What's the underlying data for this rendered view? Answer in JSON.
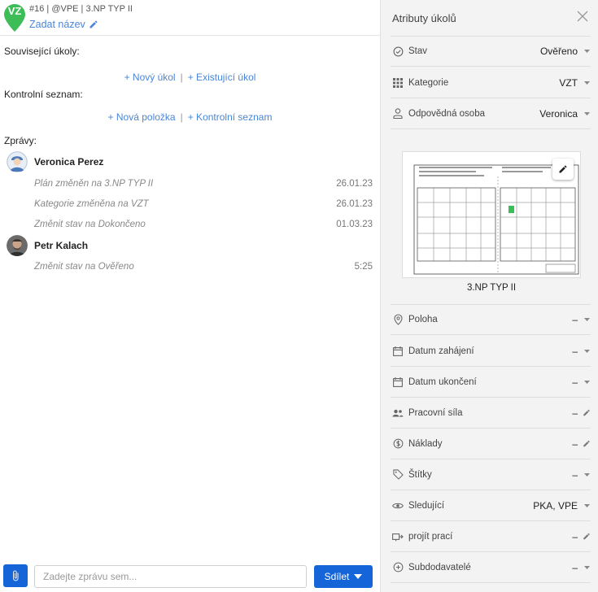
{
  "header": {
    "avatar_initials": "VZ",
    "meta": "#16 | @VPE | 3.NP TYP II",
    "set_name_label": "Zadat název"
  },
  "related": {
    "label": "Související úkoly:",
    "new_task": "+ Nový úkol",
    "existing_task": "+ Existující úkol"
  },
  "checklist": {
    "label": "Kontrolní seznam:",
    "new_item": "+ Nová položka",
    "checklist_link": "+ Kontrolní seznam"
  },
  "messages": {
    "label": "Zprávy:",
    "groups": [
      {
        "user": "Veronica Perez",
        "entries": [
          {
            "text": "Plán změněn na 3.NP TYP II",
            "date": "26.01.23"
          },
          {
            "text": "Kategorie změněna na VZT",
            "date": "26.01.23"
          },
          {
            "text": "Změnit stav na Dokončeno",
            "date": "01.03.23"
          }
        ]
      },
      {
        "user": "Petr Kalach",
        "entries": [
          {
            "text": "Změnit stav na Ověřeno",
            "date": "5:25"
          }
        ]
      }
    ]
  },
  "composer": {
    "placeholder": "Zadejte zprávu sem...",
    "share_label": "Sdílet"
  },
  "panel": {
    "title": "Atributy úkolů",
    "attrs_top": [
      {
        "icon": "check-circle-icon",
        "label": "Stav",
        "value": "Ověřeno"
      },
      {
        "icon": "grid-icon",
        "label": "Kategorie",
        "value": "VZT"
      },
      {
        "icon": "person-icon",
        "label": "Odpovědná osoba",
        "value": "Veronica"
      }
    ],
    "plan_caption": "3.NP TYP II",
    "attrs_bottom": [
      {
        "icon": "location-pin-icon",
        "label": "Poloha",
        "value": "–",
        "trail": "chevron"
      },
      {
        "icon": "calendar-icon",
        "label": "Datum zahájení",
        "value": "–",
        "trail": "chevron"
      },
      {
        "icon": "calendar-icon",
        "label": "Datum ukončení",
        "value": "–",
        "trail": "chevron"
      },
      {
        "icon": "group-icon",
        "label": "Pracovní síla",
        "value": "–",
        "trail": "pencil"
      },
      {
        "icon": "dollar-icon",
        "label": "Náklady",
        "value": "–",
        "trail": "pencil"
      },
      {
        "icon": "tag-icon",
        "label": "Štítky",
        "value": "–",
        "trail": "chevron"
      },
      {
        "icon": "eye-icon",
        "label": "Sledující",
        "value": "PKA, VPE",
        "trail": "chevron"
      },
      {
        "icon": "workflow-icon",
        "label": "projít prací",
        "value": "–",
        "trail": "pencil"
      },
      {
        "icon": "plus-circle-icon",
        "label": "Subdodavatelé",
        "value": "–",
        "trail": "chevron"
      }
    ]
  },
  "colors": {
    "accent": "#1565d8",
    "link": "#4a86d8",
    "pin_green": "#3dbd57"
  }
}
